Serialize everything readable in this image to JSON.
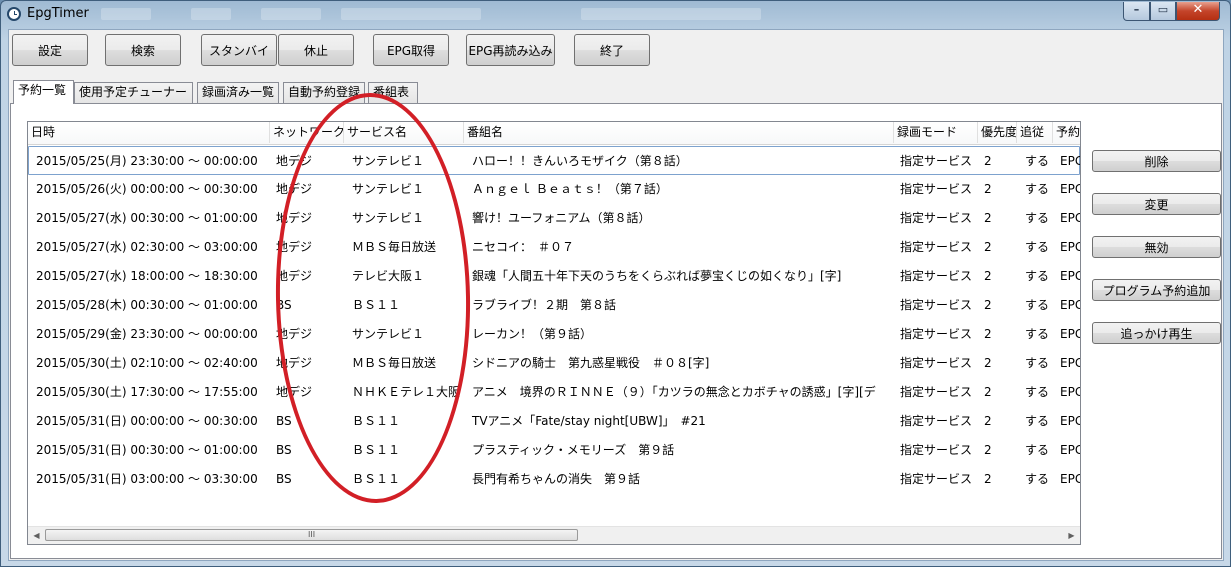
{
  "window": {
    "title": "EpgTimer"
  },
  "toolbar": {
    "buttons": [
      "設定",
      "検索",
      "スタンバイ",
      "休止",
      "EPG取得",
      "EPG再読み込み",
      "終了"
    ]
  },
  "tabs": [
    "予約一覧",
    "使用予定チューナー",
    "録画済み一覧",
    "自動予約登録",
    "番組表"
  ],
  "table": {
    "columns": [
      "日時",
      "ネットワーク",
      "サービス名",
      "番組名",
      "録画モード",
      "優先度",
      "追従",
      "予約"
    ],
    "rows": [
      [
        "2015/05/25(月) 23:30:00 ～ 00:00:00",
        "地デジ",
        "サンテレビ１",
        "ハロー！！きんいろモザイク（第８話）",
        "指定サービス",
        "2",
        "する",
        "EPG"
      ],
      [
        "2015/05/26(火) 00:00:00 ～ 00:30:00",
        "地デジ",
        "サンテレビ１",
        "Ａｎｇｅｌ Ｂｅａｔｓ！（第７話）",
        "指定サービス",
        "2",
        "する",
        "EPG"
      ],
      [
        "2015/05/27(水) 00:30:00 ～ 01:00:00",
        "地デジ",
        "サンテレビ１",
        "響け！ユーフォニアム（第８話）",
        "指定サービス",
        "2",
        "する",
        "EPG"
      ],
      [
        "2015/05/27(水) 02:30:00 ～ 03:00:00",
        "地デジ",
        "ＭＢＳ毎日放送",
        "ニセコイ：　＃０７",
        "指定サービス",
        "2",
        "する",
        "EPG"
      ],
      [
        "2015/05/27(水) 18:00:00 ～ 18:30:00",
        "地デジ",
        "テレビ大阪１",
        "銀魂「人間五十年下天のうちをくらぶれば夢宝くじの如くなり」[字]",
        "指定サービス",
        "2",
        "する",
        "EPG"
      ],
      [
        "2015/05/28(木) 00:30:00 ～ 01:00:00",
        "BS",
        "ＢＳ１１",
        "ラブライブ！２期　第８話",
        "指定サービス",
        "2",
        "する",
        "EPG"
      ],
      [
        "2015/05/29(金) 23:30:00 ～ 00:00:00",
        "地デジ",
        "サンテレビ１",
        "レーカン！（第９話）",
        "指定サービス",
        "2",
        "する",
        "EPG"
      ],
      [
        "2015/05/30(土) 02:10:00 ～ 02:40:00",
        "地デジ",
        "ＭＢＳ毎日放送",
        "シドニアの騎士　第九惑星戦役　＃０８[字]",
        "指定サービス",
        "2",
        "する",
        "EPG"
      ],
      [
        "2015/05/30(土) 17:30:00 ～ 17:55:00",
        "地デジ",
        "ＮＨＫＥテレ１大阪",
        "アニメ　境界のＲＩＮＮＥ（９）「カツラの無念とカボチャの誘惑」[字][デ",
        "指定サービス",
        "2",
        "する",
        "EPG"
      ],
      [
        "2015/05/31(日) 00:00:00 ～ 00:30:00",
        "BS",
        "ＢＳ１１",
        "TVアニメ「Fate/stay night[UBW]」　#21",
        "指定サービス",
        "2",
        "する",
        "EPG"
      ],
      [
        "2015/05/31(日) 00:30:00 ～ 01:00:00",
        "BS",
        "ＢＳ１１",
        "プラスティック・メモリーズ　第９話",
        "指定サービス",
        "2",
        "する",
        "EPG"
      ],
      [
        "2015/05/31(日) 03:00:00 ～ 03:30:00",
        "BS",
        "ＢＳ１１",
        "長門有希ちゃんの消失　第９話",
        "指定サービス",
        "2",
        "する",
        "EPG"
      ]
    ]
  },
  "side_buttons": [
    "削除",
    "変更",
    "無効",
    "プログラム予約追加",
    "追っかけ再生"
  ],
  "scrollbar": {
    "grip": "III"
  },
  "colors": {
    "annotation": "#d21f26",
    "selection_border": "#7da2ce"
  },
  "icons": {
    "window_min": "minimize-icon",
    "window_max": "maximize-icon",
    "window_close": "close-icon"
  }
}
